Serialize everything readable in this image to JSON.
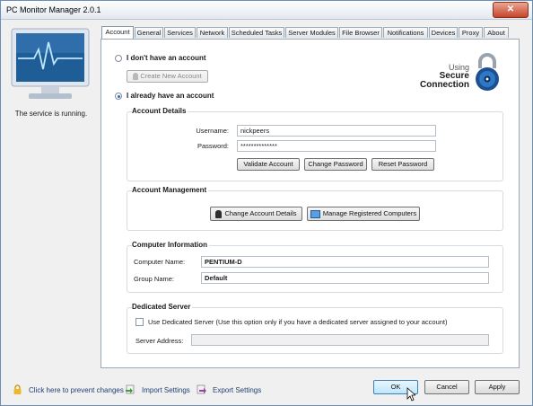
{
  "window": {
    "title": "PC Monitor Manager 2.0.1",
    "close_glyph": "✕"
  },
  "sidebar": {
    "status_text": "The service is running."
  },
  "tabs": [
    {
      "label": "Account"
    },
    {
      "label": "General"
    },
    {
      "label": "Services"
    },
    {
      "label": "Network"
    },
    {
      "label": "Scheduled Tasks"
    },
    {
      "label": "Server Modules"
    },
    {
      "label": "File Browser"
    },
    {
      "label": "Notifications"
    },
    {
      "label": "Devices"
    },
    {
      "label": "Proxy"
    },
    {
      "label": "About"
    }
  ],
  "active_tab": "Account",
  "account": {
    "no_account_label": "I don't have an account",
    "create_account_button": "Create New Account",
    "have_account_label": "I already have an account",
    "selected_option": "I already have an account",
    "secure": {
      "line1": "Using",
      "line2": "Secure",
      "line3": "Connection"
    }
  },
  "account_details": {
    "heading": "Account Details",
    "username_label": "Username:",
    "username_value": "nickpeers",
    "password_label": "Password:",
    "password_value": "**************",
    "validate_button": "Validate Account",
    "change_password_button": "Change Password",
    "reset_password_button": "Reset Password"
  },
  "account_management": {
    "heading": "Account Management",
    "change_details_button": "Change Account Details",
    "manage_computers_button": "Manage Registered Computers"
  },
  "computer_info": {
    "heading": "Computer Information",
    "computer_name_label": "Computer Name:",
    "computer_name_value": "PENTIUM-D",
    "group_name_label": "Group Name:",
    "group_name_value": "Default"
  },
  "dedicated_server": {
    "heading": "Dedicated Server",
    "checkbox_label": "Use Dedicated Server (Use this option only if you have a dedicated server assigned to your account)",
    "checked": false,
    "server_address_label": "Server Address:",
    "server_address_value": ""
  },
  "footer": {
    "prevent_changes_link": "Click here to prevent changes",
    "import_link": "Import Settings",
    "export_link": "Export Settings",
    "ok_button": "OK",
    "cancel_button": "Cancel",
    "apply_button": "Apply"
  }
}
